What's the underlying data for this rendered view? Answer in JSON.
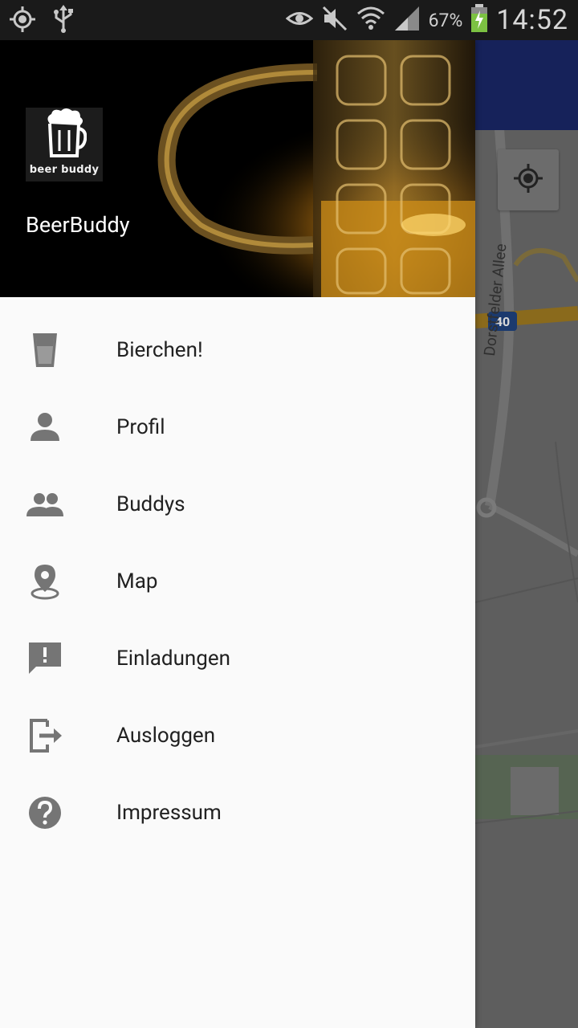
{
  "status_bar": {
    "battery_percent": "67%",
    "time": "14:52",
    "icons": [
      "gps-icon",
      "usb-icon",
      "eye-icon",
      "mute-icon",
      "wifi-icon",
      "signal-icon",
      "battery-icon"
    ]
  },
  "drawer": {
    "header": {
      "logo_text": "beer buddy",
      "app_name": "BeerBuddy"
    },
    "items": [
      {
        "label": "Bierchen!",
        "icon": "beer-glass-icon"
      },
      {
        "label": "Profil",
        "icon": "person-icon"
      },
      {
        "label": "Buddys",
        "icon": "people-icon"
      },
      {
        "label": "Map",
        "icon": "map-pin-icon"
      },
      {
        "label": "Einladungen",
        "icon": "feedback-icon"
      },
      {
        "label": "Ausloggen",
        "icon": "logout-icon"
      },
      {
        "label": "Impressum",
        "icon": "help-icon"
      }
    ]
  },
  "map": {
    "road_name": "Dorstfelder Allee",
    "road_number": "40"
  },
  "colors": {
    "drawer_bg": "#fafafa",
    "toolbar": "#16225a",
    "icon_gray": "#757575",
    "text": "#212121"
  }
}
